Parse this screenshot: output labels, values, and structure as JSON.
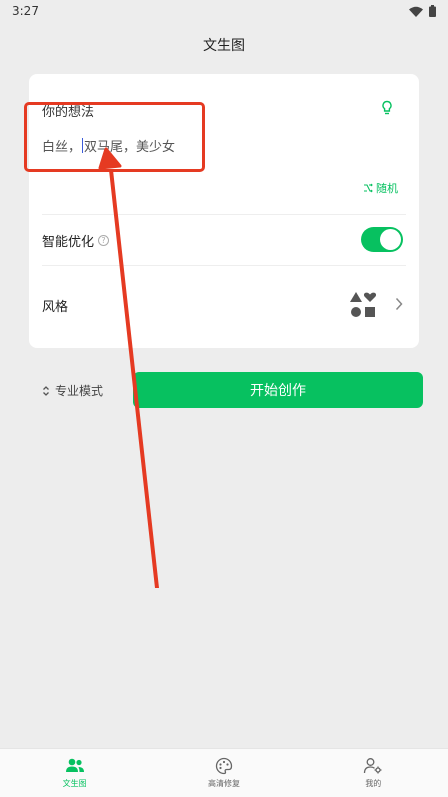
{
  "status_bar": {
    "time": "3:27",
    "icons": [
      "wifi-icon",
      "battery-icon"
    ]
  },
  "header": {
    "title": "文生图"
  },
  "idea": {
    "label": "你的想法",
    "text_before": "白丝，",
    "text_after": "双马尾，美少女",
    "bulb_icon": "lightbulb-icon"
  },
  "random": {
    "label": "随机",
    "icon": "shuffle-icon"
  },
  "smart_opt": {
    "label": "智能优化",
    "help_icon": "help-icon",
    "enabled": true
  },
  "style": {
    "label": "风格",
    "icon": "shapes-icon"
  },
  "mode": {
    "label": "专业模式",
    "icon": "sort-icon"
  },
  "start": {
    "label": "开始创作"
  },
  "nav": [
    {
      "label": "文生图",
      "icon": "people-icon",
      "active": true
    },
    {
      "label": "高清修复",
      "icon": "palette-icon",
      "active": false
    },
    {
      "label": "我的",
      "icon": "user-settings-icon",
      "active": false
    }
  ],
  "colors": {
    "accent": "#07c160",
    "annotation": "#e53a22",
    "background": "#ededed"
  }
}
